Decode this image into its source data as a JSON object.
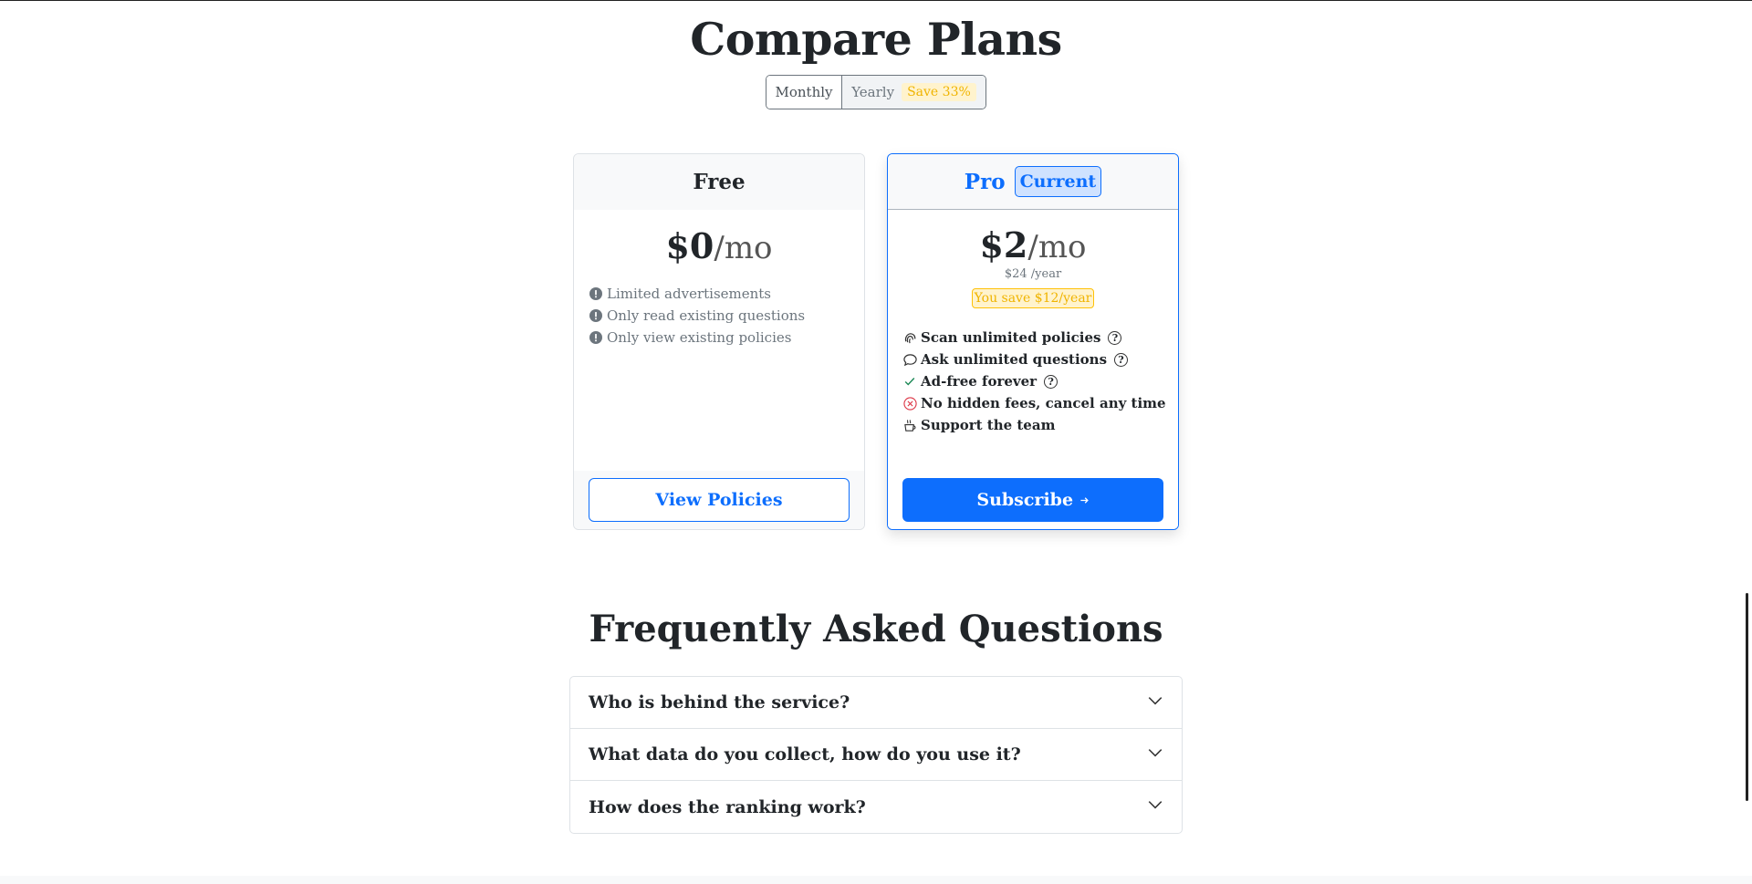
{
  "page": {
    "title": "Compare Plans"
  },
  "billing_toggle": {
    "monthly_label": "Monthly",
    "yearly_label": "Yearly",
    "save_badge": "Save 33%"
  },
  "plans": {
    "free": {
      "name": "Free",
      "price": "$0",
      "unit": "/mo",
      "features": [
        "Limited advertisements",
        "Only read existing questions",
        "Only view existing policies"
      ],
      "button": "View Policies"
    },
    "pro": {
      "name": "Pro",
      "badge": "Current",
      "price": "$2",
      "unit": "/mo",
      "per_year": "$24 /year",
      "you_save": "You save $12/year",
      "features": [
        {
          "label": "Scan unlimited policies",
          "icon": "fingerprint-icon",
          "help": true
        },
        {
          "label": "Ask unlimited questions",
          "icon": "chat-bubble-icon",
          "help": true
        },
        {
          "label": "Ad-free forever",
          "icon": "check-icon",
          "help": true
        },
        {
          "label": "No hidden fees, cancel any time",
          "icon": "x-circle-icon",
          "help": false
        },
        {
          "label": "Support the team",
          "icon": "coffee-cup-icon",
          "help": false
        }
      ],
      "button": "Subscribe",
      "button_icon": "arrow-right-icon"
    }
  },
  "faq": {
    "title": "Frequently Asked Questions",
    "items": [
      "Who is behind the service?",
      "What data do you collect, how do you use it?",
      "How does the ranking work?"
    ]
  },
  "colors": {
    "primary": "#0d6efd",
    "warning": "#ffc107",
    "muted": "#6c757d",
    "danger": "#dc3545",
    "success": "#198754"
  }
}
